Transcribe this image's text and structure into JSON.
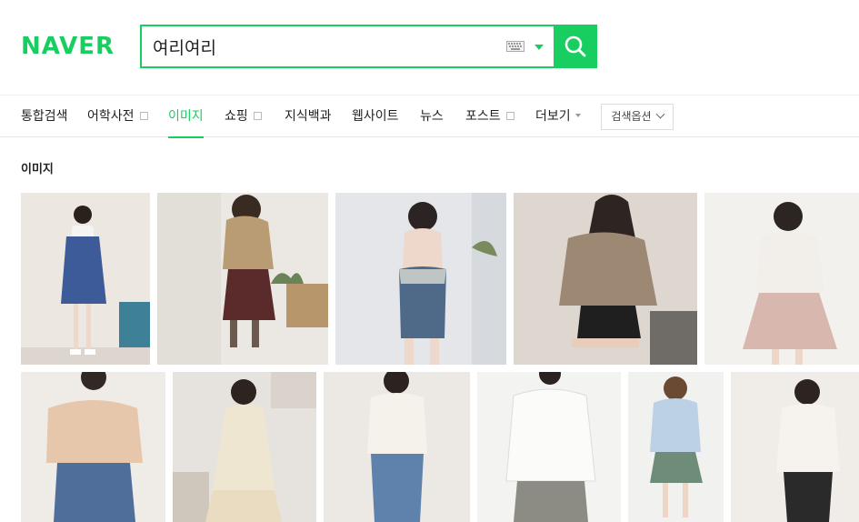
{
  "logo": "NAVER",
  "search": {
    "query": "여리여리"
  },
  "tabs": [
    {
      "label": "통합검색"
    },
    {
      "label": "어학사전"
    },
    {
      "label": "이미지"
    },
    {
      "label": "쇼핑"
    },
    {
      "label": "지식백과"
    },
    {
      "label": "웹사이트"
    },
    {
      "label": "뉴스"
    },
    {
      "label": "포스트"
    },
    {
      "label": "더보기"
    }
  ],
  "active_tab": "이미지",
  "search_options_label": "검색옵션",
  "section_title": "이미지",
  "colors": {
    "brand": "#19ce60"
  },
  "images": [
    {
      "desc": "woman in blue overall dress with white shirt"
    },
    {
      "desc": "woman in beige knit sweater and burgundy skirt"
    },
    {
      "desc": "woman in blue lace swimsuit"
    },
    {
      "desc": "woman in beige off-shoulder knit and black leather shorts"
    },
    {
      "desc": "woman in white blouse and pink pleated skirt"
    },
    {
      "desc": "woman in beige off-shoulder top and jeans"
    },
    {
      "desc": "woman in cream floral dress"
    },
    {
      "desc": "woman in white long-sleeve top and jeans"
    },
    {
      "desc": "woman in white blouse"
    },
    {
      "desc": "woman in light blue blouse and checked skirt"
    },
    {
      "desc": "woman in white shirt and black pants"
    }
  ]
}
